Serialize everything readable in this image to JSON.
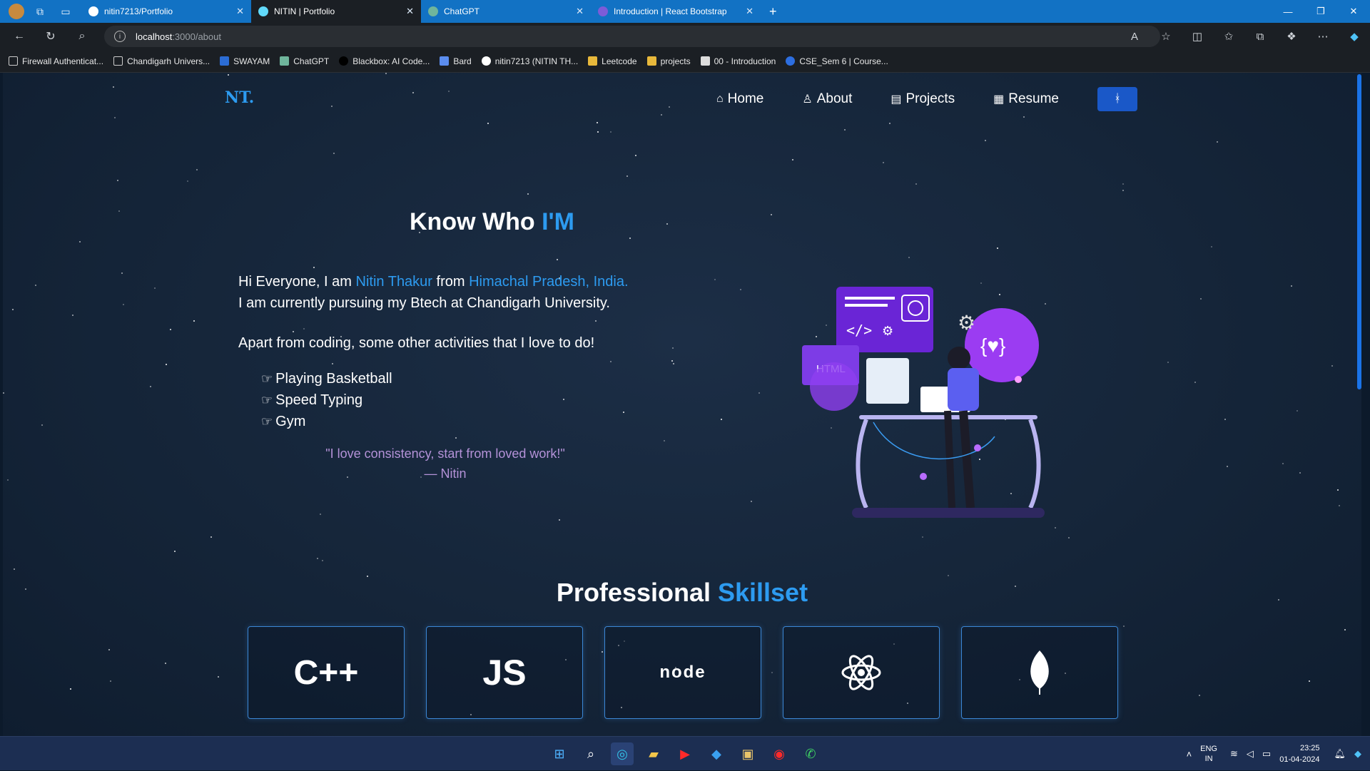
{
  "browser": {
    "tabs": [
      {
        "title": "nitin7213/Portfolio",
        "active": false
      },
      {
        "title": "NITIN | Portfolio",
        "active": true
      },
      {
        "title": "ChatGPT",
        "active": false
      },
      {
        "title": "Introduction | React Bootstrap",
        "active": false
      }
    ],
    "url_host": "localhost",
    "url_path": ":3000/about",
    "bookmarks": [
      "Firewall Authenticat...",
      "Chandigarh Univers...",
      "SWAYAM",
      "ChatGPT",
      "Blackbox: AI Code...",
      "Bard",
      "nitin7213 (NITIN TH...",
      "Leetcode",
      "projects",
      "00 - Introduction",
      "CSE_Sem 6 | Course..."
    ]
  },
  "site": {
    "brand": "NT.",
    "nav": {
      "home": "Home",
      "about": "About",
      "projects": "Projects",
      "resume": "Resume"
    },
    "about": {
      "heading_a": "Know Who ",
      "heading_b": "I'M",
      "line1_a": "Hi Everyone, I am ",
      "line1_name": "Nitin Thakur",
      "line1_b": " from ",
      "line1_place": "Himachal Pradesh, India.",
      "line2": "I am currently pursuing my Btech at Chandigarh University.",
      "apart": "Apart from coding, some other activities that I love to do!",
      "activities": [
        "Playing Basketball",
        "Speed Typing",
        "Gym"
      ],
      "quote": "\"I love consistency, start from loved work!\"",
      "quote_author": "— Nitin",
      "illustration_label": "HTML"
    },
    "skills": {
      "heading_a": "Professional ",
      "heading_b": "Skillset",
      "items": [
        "C++",
        "JS",
        "node",
        "react",
        "mongodb"
      ]
    }
  },
  "taskbar": {
    "lang_top": "ENG",
    "lang_bottom": "IN",
    "time": "23:25",
    "date": "01-04-2024"
  }
}
